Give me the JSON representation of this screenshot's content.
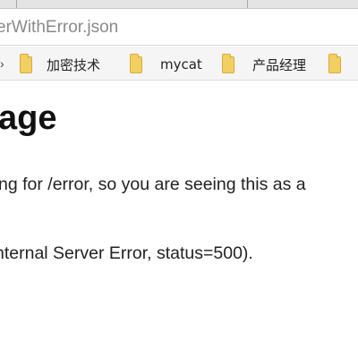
{
  "browser": {
    "url": "erWithError.json"
  },
  "bookmarks": [
    {
      "label": "",
      "icon": "folder-icon"
    },
    {
      "label": "加密技术",
      "icon": "folder-icon"
    },
    {
      "label": "mycat",
      "icon": "folder-icon"
    },
    {
      "label": "产品经理",
      "icon": "folder-icon"
    },
    {
      "label": "",
      "icon": "folder-icon"
    }
  ],
  "page": {
    "heading": "age",
    "line1": "ng for /error, so you are seeing this as a",
    "line2": "nternal Server Error, status=500)."
  },
  "colors": {
    "folder": "#f2cf62",
    "text": "#222222",
    "url_text": "#8a8a8a"
  }
}
